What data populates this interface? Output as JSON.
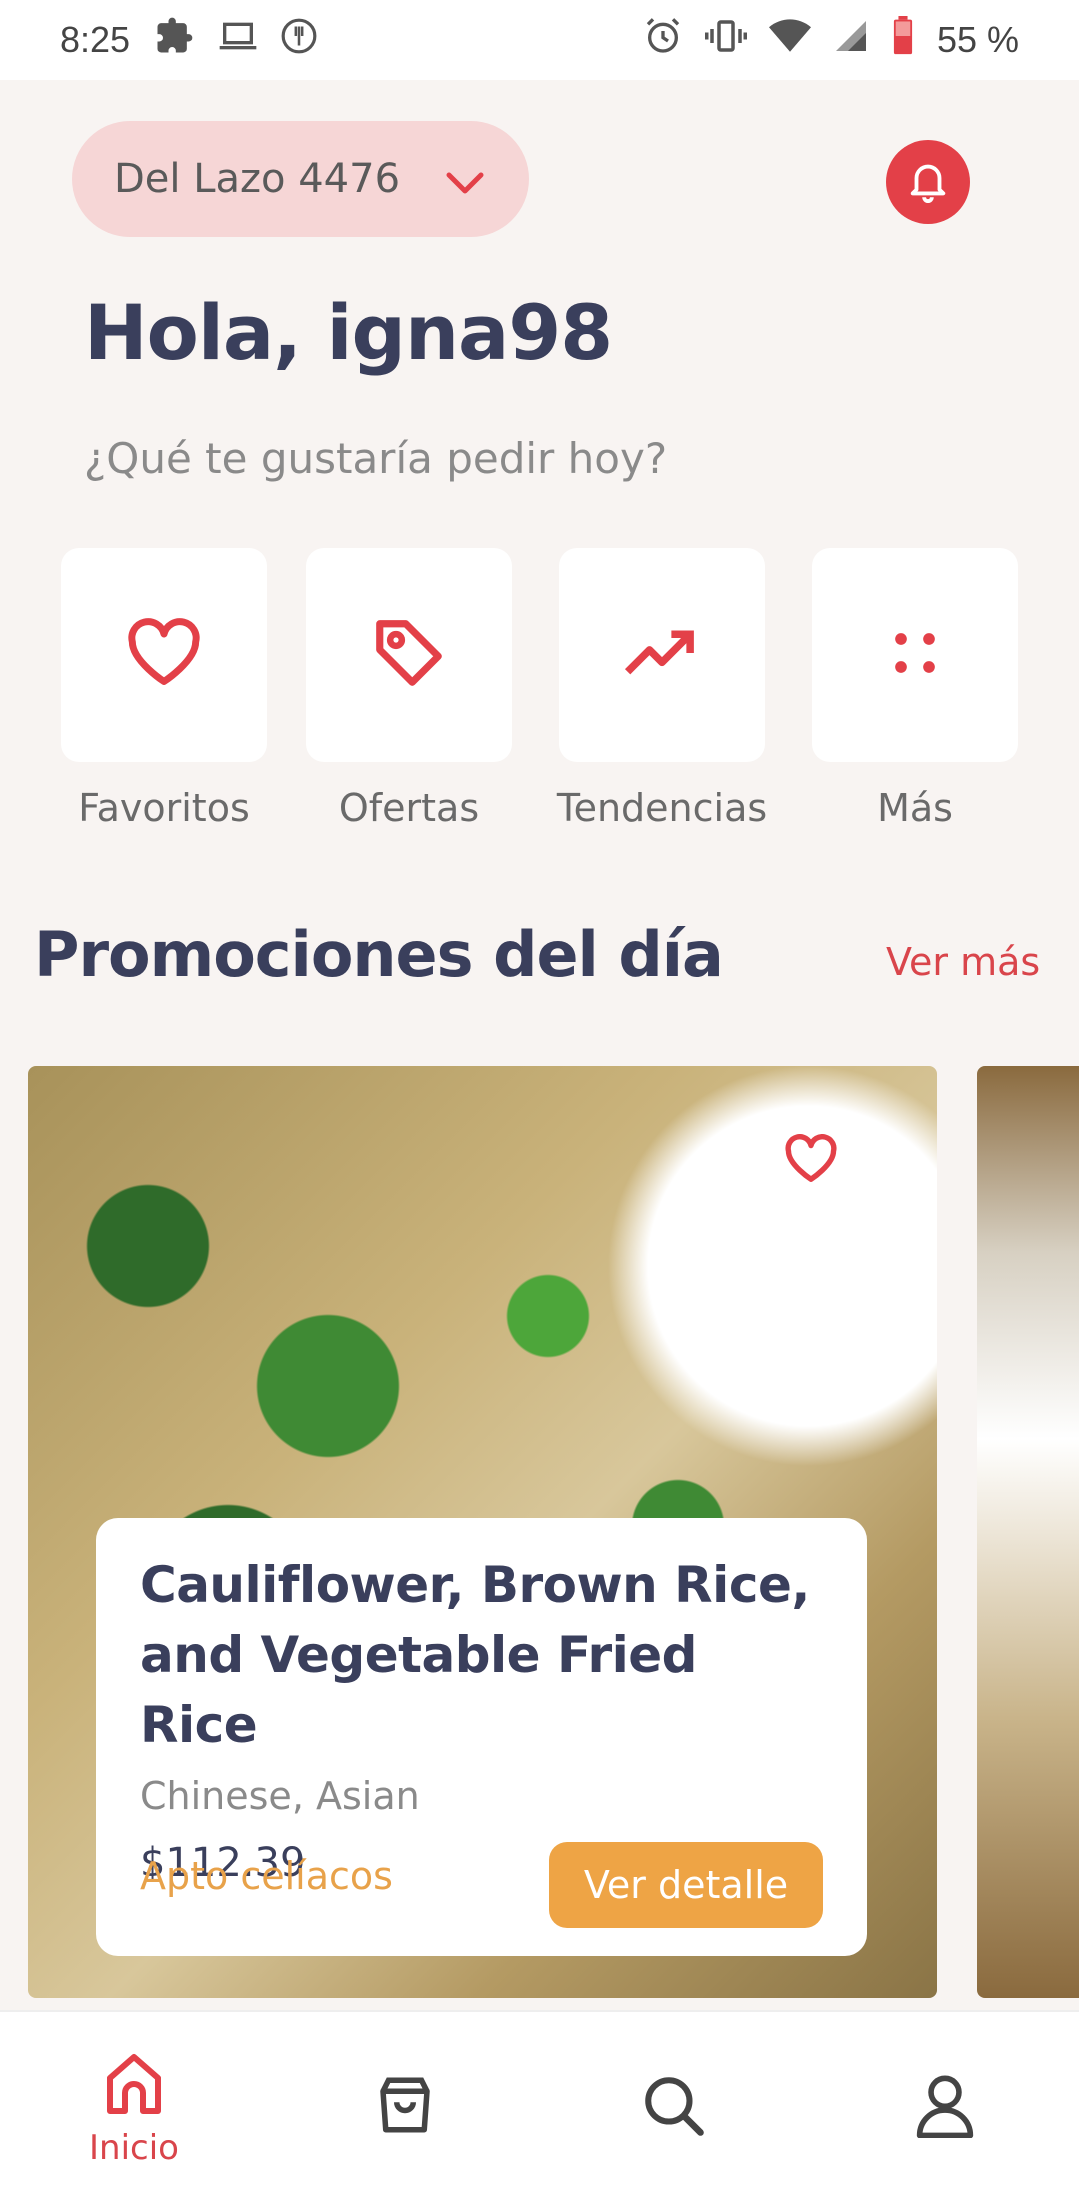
{
  "status_bar": {
    "time": "8:25",
    "battery": "55 %",
    "icons_left": [
      "puzzle-icon",
      "laptop-icon",
      "restaurant-icon"
    ],
    "icons_right": [
      "alarm-icon",
      "vibrate-icon",
      "wifi-icon",
      "signal-icon",
      "battery-icon"
    ]
  },
  "header": {
    "location": "Del Lazo 4476",
    "greeting": "Hola, igna98",
    "question": "¿Qué te gustaría pedir hoy?"
  },
  "categories": [
    {
      "label": "Favoritos",
      "icon": "heart-icon"
    },
    {
      "label": "Ofertas",
      "icon": "tag-icon"
    },
    {
      "label": "Tendencias",
      "icon": "trending-icon"
    },
    {
      "label": "Más",
      "icon": "more-dots-icon"
    }
  ],
  "promotions": {
    "title": "Promociones del día",
    "see_more": "Ver más",
    "card": {
      "title_line1": "Cauliflower, Brown Rice,",
      "title_line2": "and Vegetable Fried Rice",
      "cuisine": "Chinese, Asian",
      "price": "$112.39",
      "flag": "Apto celíacos",
      "button": "Ver detalle"
    }
  },
  "nav": {
    "home_label": "Inicio"
  },
  "colors": {
    "accent": "#e34048",
    "orange": "#eea445",
    "title": "#3a3f5c",
    "background": "#f8f4f2"
  }
}
